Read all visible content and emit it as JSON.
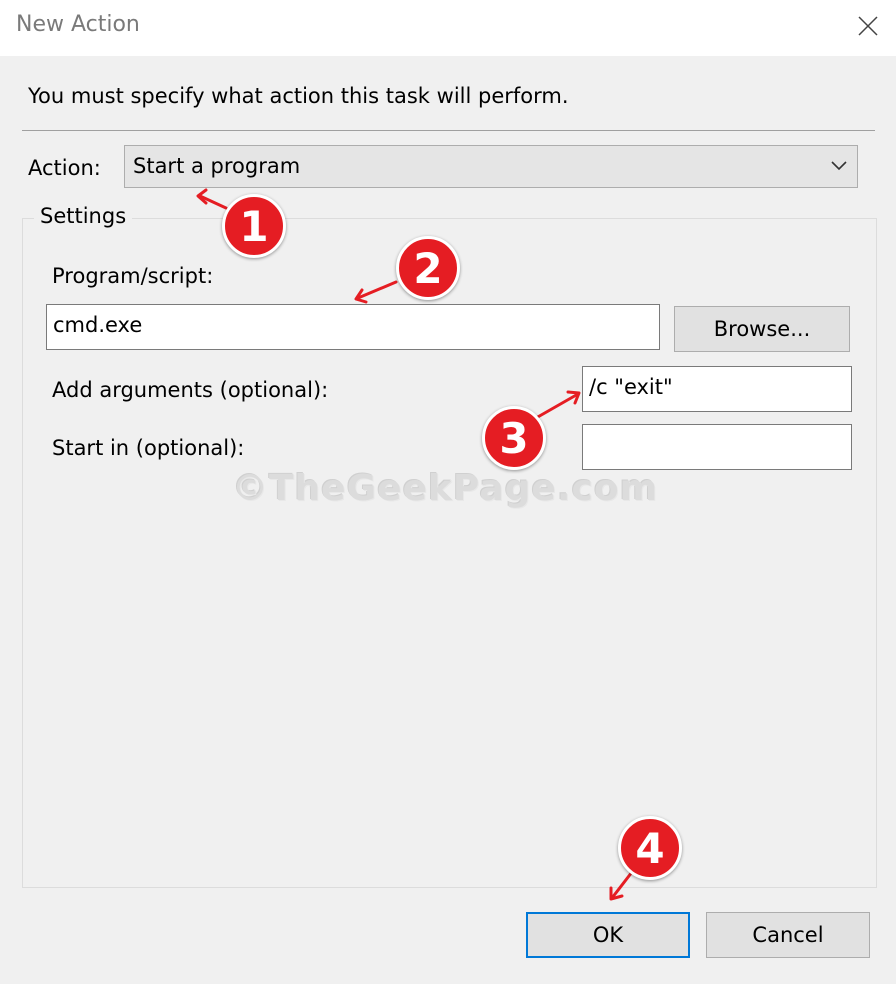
{
  "window": {
    "title": "New Action",
    "close_icon": "close-icon"
  },
  "instruction": "You must specify what action this task will perform.",
  "action": {
    "label": "Action:",
    "selected": "Start a program"
  },
  "settings": {
    "group_title": "Settings",
    "program_label": "Program/script:",
    "program_value": "cmd.exe",
    "browse_label": "Browse...",
    "arguments_label": "Add arguments (optional):",
    "arguments_value": "/c \"exit\"",
    "start_in_label": "Start in (optional):",
    "start_in_value": ""
  },
  "buttons": {
    "ok": "OK",
    "cancel": "Cancel"
  },
  "watermark": "©TheGeekPage.com",
  "annotations": {
    "color": "#e51d23",
    "steps": [
      "1",
      "2",
      "3",
      "4"
    ]
  }
}
